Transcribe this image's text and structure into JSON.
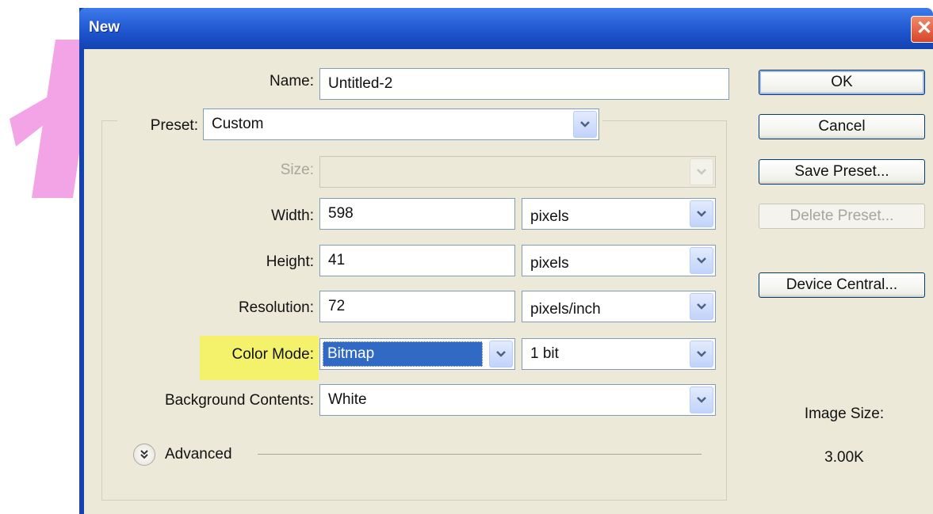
{
  "window": {
    "title": "New",
    "close_glyph": "✕"
  },
  "form": {
    "name": {
      "label": "Name:",
      "value": "Untitled-2"
    },
    "preset": {
      "label": "Preset:",
      "value": "Custom"
    },
    "size": {
      "label": "Size:",
      "value": "",
      "disabled": true
    },
    "width": {
      "label": "Width:",
      "value": "598",
      "unit": "pixels"
    },
    "height": {
      "label": "Height:",
      "value": "41",
      "unit": "pixels"
    },
    "resolution": {
      "label": "Resolution:",
      "value": "72",
      "unit": "pixels/inch"
    },
    "color_mode": {
      "label": "Color Mode:",
      "value": "Bitmap",
      "depth": "1 bit"
    },
    "background": {
      "label": "Background Contents:",
      "value": "White"
    },
    "advanced": {
      "label": "Advanced"
    }
  },
  "buttons": {
    "ok": "OK",
    "cancel": "Cancel",
    "save_preset": "Save Preset...",
    "delete_preset": "Delete Preset...",
    "device_central": "Device Central..."
  },
  "image_size": {
    "label": "Image Size:",
    "value": "3.00K"
  },
  "icons": {
    "dropdown": "chevron-down-icon",
    "advanced": "double-chevron-down-icon",
    "close": "close-icon"
  },
  "colors": {
    "titlebar": "#2a63da",
    "dialog_bg": "#ece9d8",
    "highlight": "#f4f26a",
    "selection": "#316ac5",
    "deco_pink": "#f3a4e6"
  }
}
